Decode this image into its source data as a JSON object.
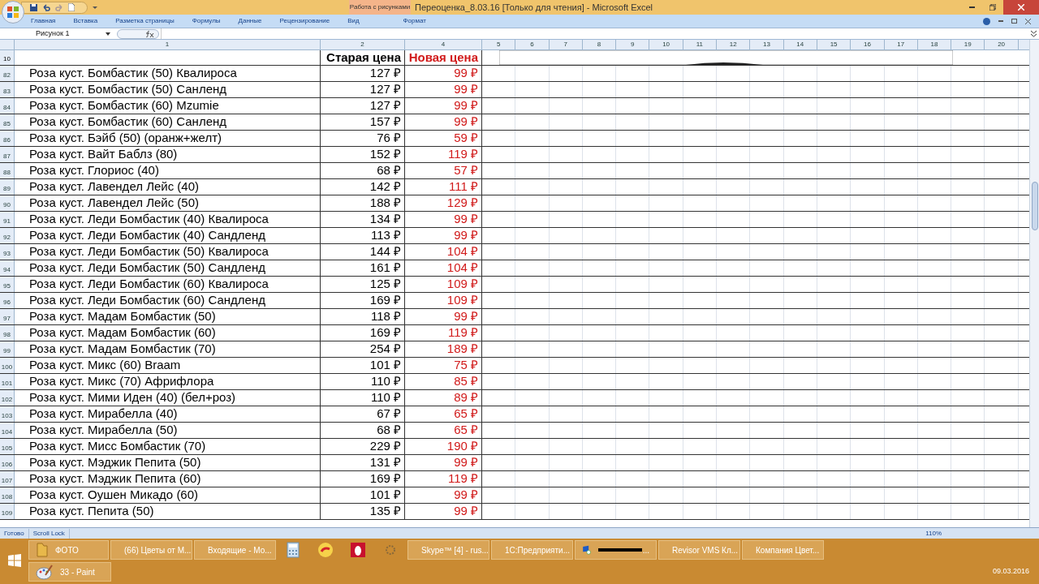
{
  "window": {
    "title": "Переоценка_8.03.16  [Только для чтения]  -  Microsoft Excel",
    "context_tab": "Работа с рисунками"
  },
  "ribbon_tabs": [
    "Главная",
    "Вставка",
    "Разметка страницы",
    "Формулы",
    "Данные",
    "Рецензирование",
    "Вид"
  ],
  "context_ribbon_tab": "Формат",
  "name_box": "Рисунок 1",
  "column_headers": [
    "1",
    "2",
    "4",
    "5",
    "6",
    "7",
    "8",
    "9",
    "10",
    "11",
    "12",
    "13",
    "14",
    "15",
    "16",
    "17",
    "18",
    "19",
    "20"
  ],
  "header_row": {
    "number": "10",
    "old_price": "Старая цена",
    "new_price": "Новая цена"
  },
  "rows": [
    {
      "number": "82",
      "name": "Роза куст. Бомбастик (50) Квалироса",
      "old_price": "127 ₽",
      "new_price": "99 ₽"
    },
    {
      "number": "83",
      "name": "Роза куст. Бомбастик (50) Санленд",
      "old_price": "127 ₽",
      "new_price": "99 ₽"
    },
    {
      "number": "84",
      "name": "Роза куст. Бомбастик (60) Mzumie",
      "old_price": "127 ₽",
      "new_price": "99 ₽"
    },
    {
      "number": "85",
      "name": "Роза куст. Бомбастик (60) Санленд",
      "old_price": "157 ₽",
      "new_price": "99 ₽"
    },
    {
      "number": "86",
      "name": "Роза куст. Бэйб (50) (оранж+желт)",
      "old_price": "76 ₽",
      "new_price": "59 ₽"
    },
    {
      "number": "87",
      "name": "Роза куст. Вайт Баблз (80)",
      "old_price": "152 ₽",
      "new_price": "119 ₽"
    },
    {
      "number": "88",
      "name": "Роза куст. Глориос (40)",
      "old_price": "68 ₽",
      "new_price": "57 ₽"
    },
    {
      "number": "89",
      "name": "Роза куст. Лавендел Лейс (40)",
      "old_price": "142 ₽",
      "new_price": "111 ₽"
    },
    {
      "number": "90",
      "name": "Роза куст. Лавендел Лейс (50)",
      "old_price": "188 ₽",
      "new_price": "129 ₽"
    },
    {
      "number": "91",
      "name": "Роза куст. Леди Бомбастик (40) Квалироса",
      "old_price": "134 ₽",
      "new_price": "99 ₽"
    },
    {
      "number": "92",
      "name": "Роза куст. Леди Бомбастик (40) Сандленд",
      "old_price": "113 ₽",
      "new_price": "99 ₽"
    },
    {
      "number": "93",
      "name": "Роза куст. Леди Бомбастик (50) Квалироса",
      "old_price": "144 ₽",
      "new_price": "104 ₽"
    },
    {
      "number": "94",
      "name": "Роза куст. Леди Бомбастик (50) Сандленд",
      "old_price": "161 ₽",
      "new_price": "104 ₽"
    },
    {
      "number": "95",
      "name": "Роза куст. Леди Бомбастик (60) Квалироса",
      "old_price": "125 ₽",
      "new_price": "109 ₽"
    },
    {
      "number": "96",
      "name": "Роза куст. Леди Бомбастик (60) Сандленд",
      "old_price": "169 ₽",
      "new_price": "109 ₽"
    },
    {
      "number": "97",
      "name": "Роза куст. Мадам Бомбастик (50)",
      "old_price": "118 ₽",
      "new_price": "99 ₽"
    },
    {
      "number": "98",
      "name": "Роза куст. Мадам Бомбастик (60)",
      "old_price": "169 ₽",
      "new_price": "119 ₽"
    },
    {
      "number": "99",
      "name": "Роза куст. Мадам Бомбастик (70)",
      "old_price": "254 ₽",
      "new_price": "189 ₽"
    },
    {
      "number": "100",
      "name": "Роза куст. Микс (60) Braam",
      "old_price": "101 ₽",
      "new_price": "75 ₽"
    },
    {
      "number": "101",
      "name": "Роза куст. Микс (70) Африфлора",
      "old_price": "110 ₽",
      "new_price": "85 ₽"
    },
    {
      "number": "102",
      "name": "Роза куст. Мими Иден (40) (бел+роз)",
      "old_price": "110 ₽",
      "new_price": "89 ₽"
    },
    {
      "number": "103",
      "name": "Роза куст. Мирабелла (40)",
      "old_price": "67 ₽",
      "new_price": "65 ₽"
    },
    {
      "number": "104",
      "name": "Роза куст. Мирабелла (50)",
      "old_price": "68 ₽",
      "new_price": "65 ₽"
    },
    {
      "number": "105",
      "name": "Роза куст. Мисс Бомбастик (70)",
      "old_price": "229 ₽",
      "new_price": "190 ₽"
    },
    {
      "number": "106",
      "name": "Роза куст. Мэджик Пепита (50)",
      "old_price": "131 ₽",
      "new_price": "99 ₽"
    },
    {
      "number": "107",
      "name": "Роза куст. Мэджик Пепита (60)",
      "old_price": "169 ₽",
      "new_price": "119 ₽"
    },
    {
      "number": "108",
      "name": "Роза куст. Оушен Микадо (60)",
      "old_price": "101 ₽",
      "new_price": "99 ₽"
    },
    {
      "number": "109",
      "name": "Роза куст. Пепита (50)",
      "old_price": "135 ₽",
      "new_price": "99 ₽"
    }
  ],
  "status_bar": {
    "items": [
      "Готово",
      "Scroll Lock"
    ],
    "zoom": "110%"
  },
  "taskbar": {
    "row_1": [
      {
        "kind": "folder",
        "label": "ФОТО"
      },
      {
        "kind": "chrome",
        "label": "(66) Цветы от М..."
      },
      {
        "kind": "mail",
        "label": "Входящие - Mo..."
      },
      {
        "kind": "calculator"
      },
      {
        "kind": "onec"
      },
      {
        "kind": "egg"
      },
      {
        "kind": "gear"
      },
      {
        "kind": "skype",
        "label": "Skype™ [4] - rus..."
      },
      {
        "kind": "onec",
        "label": "1С:Предприяти..."
      },
      {
        "kind": "remote",
        "label": "..."
      },
      {
        "kind": "wave",
        "label": "Revisor VMS Кл..."
      },
      {
        "kind": "emblem",
        "label": "Компания Цвет..."
      }
    ],
    "row_2": [
      {
        "kind": "paint",
        "label": "33 - Paint"
      }
    ],
    "date": "09.03.2016"
  }
}
